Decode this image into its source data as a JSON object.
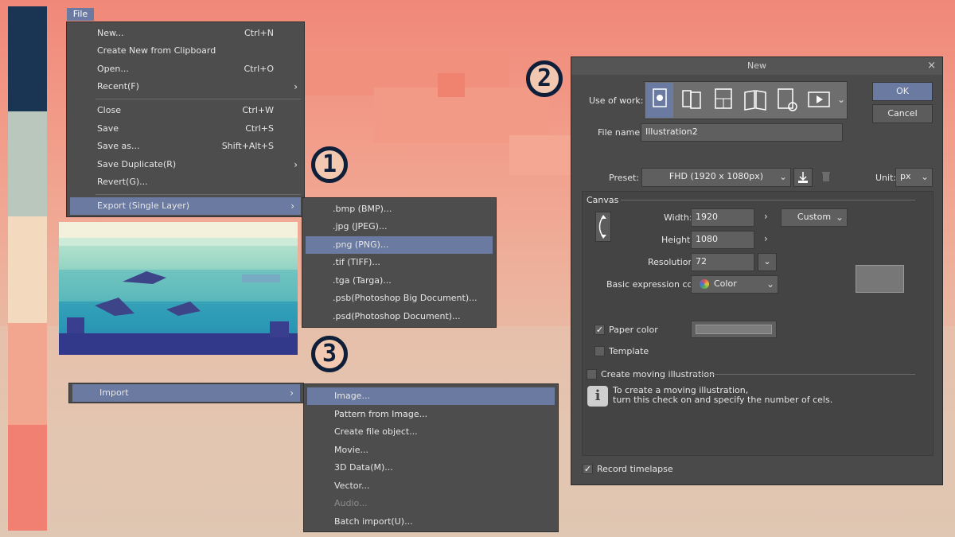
{
  "palette": [
    "#193553",
    "#b9c7bd",
    "#f3d9bd",
    "#f3a68f",
    "#f18072"
  ],
  "file_menu": {
    "tab_label": "File",
    "items": [
      {
        "label": "New...",
        "shortcut": "Ctrl+N"
      },
      {
        "label": "Create New from Clipboard",
        "shortcut": ""
      },
      {
        "label": "Open...",
        "shortcut": "Ctrl+O"
      },
      {
        "label": "Recent(F)",
        "shortcut": ""
      },
      {
        "label": "Close",
        "shortcut": "Ctrl+W"
      },
      {
        "label": "Save",
        "shortcut": "Ctrl+S"
      },
      {
        "label": "Save as...",
        "shortcut": "Shift+Alt+S"
      },
      {
        "label": "Save Duplicate(R)",
        "shortcut": ""
      },
      {
        "label": "Revert(G)...",
        "shortcut": ""
      },
      {
        "label": "Export (Single Layer)",
        "shortcut": ""
      }
    ],
    "submenu_arrow": "›"
  },
  "export_submenu": {
    "items": [
      ".bmp (BMP)...",
      ".jpg (JPEG)...",
      ".png (PNG)...",
      ".tif (TIFF)...",
      ".tga (Targa)...",
      ".psb(Photoshop Big Document)...",
      ".psd(Photoshop Document)..."
    ]
  },
  "import_menu": {
    "label": "Import",
    "items": [
      "Image...",
      "Pattern from Image...",
      "Create file object...",
      "Movie...",
      "3D Data(M)...",
      "Vector...",
      "Audio...",
      "Batch import(U)..."
    ]
  },
  "badges": {
    "one": "1",
    "two": "2",
    "three": "3"
  },
  "new_dialog": {
    "title": "New",
    "close": "×",
    "use_of_work_label": "Use of work:",
    "work_icons": [
      "illustration-icon",
      "comic-icon",
      "webtoon-icon",
      "book-icon",
      "custom-settings-icon",
      "animation-icon"
    ],
    "ok": "OK",
    "cancel": "Cancel",
    "file_name_label": "File name:",
    "file_name": "Illustration2",
    "preset_label": "Preset:",
    "preset": "FHD (1920 x 1080px)",
    "unit_label": "Unit:",
    "unit": "px",
    "canvas_label": "Canvas",
    "width_label": "Width:",
    "width": "1920",
    "height_label": "Height:",
    "height": "1080",
    "size_preset": "Custom",
    "resolution_label": "Resolution:",
    "resolution": "72",
    "expression_label": "Basic expression color:",
    "expression": "Color",
    "paper_color_label": "Paper color",
    "paper_color_checked": true,
    "template_label": "Template",
    "template_checked": false,
    "moving_label": "Create moving illustration",
    "moving_checked": false,
    "info_line1": "To create a moving illustration,",
    "info_line2": "turn this check on and specify the number of cels.",
    "timelapse_label": "Record timelapse",
    "timelapse_checked": true,
    "accent": "#6a7aa0"
  }
}
